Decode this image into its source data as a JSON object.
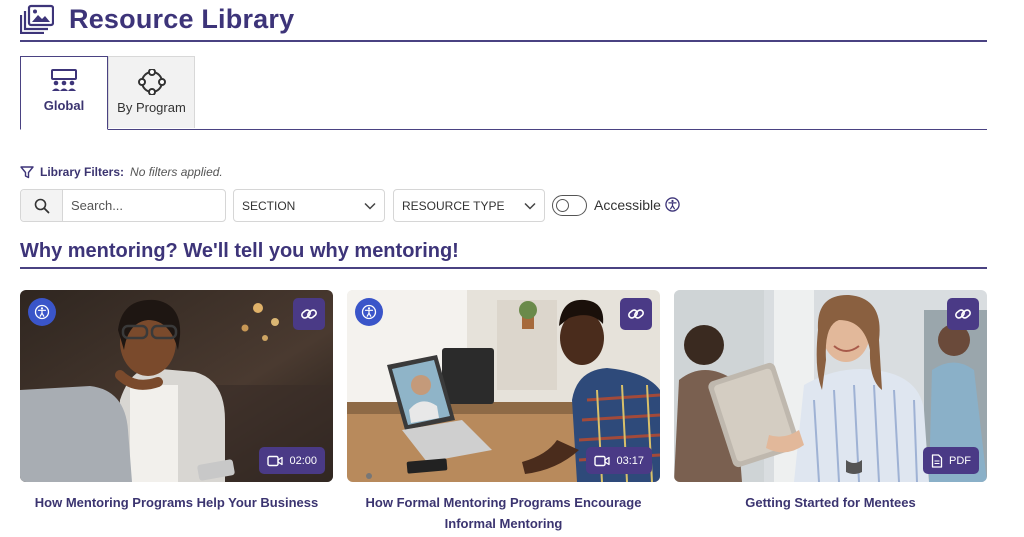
{
  "header": {
    "title": "Resource Library",
    "icon": "photo-library-icon"
  },
  "tabs": [
    {
      "label": "Global",
      "icon": "group-icon",
      "active": true
    },
    {
      "label": "By Program",
      "icon": "program-network-icon",
      "active": false
    }
  ],
  "filters": {
    "label": "Library Filters:",
    "status": "No filters applied.",
    "search_placeholder": "Search...",
    "section_label": "SECTION",
    "resource_type_label": "RESOURCE TYPE",
    "accessible_label": "Accessible",
    "accessible_on": false
  },
  "section": {
    "title": "Why mentoring? We'll tell you why mentoring!"
  },
  "cards": [
    {
      "title": "How Mentoring Programs Help Your Business",
      "meta": "02:00",
      "meta_icon": "video-icon",
      "accessible": true
    },
    {
      "title": "How Formal Mentoring Programs Encourage Informal Mentoring",
      "meta": "03:17",
      "meta_icon": "video-icon",
      "accessible": true
    },
    {
      "title": "Getting Started for Mentees",
      "meta": "PDF",
      "meta_icon": "document-icon",
      "accessible": false
    }
  ],
  "colors": {
    "primary": "#3d3479",
    "badge": "#4a3a86",
    "accessible_badge": "#3a55c9"
  }
}
